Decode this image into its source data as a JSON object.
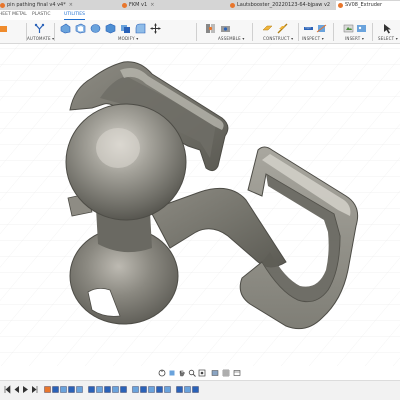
{
  "tabs": [
    {
      "label": "pin pathing final v4 v4*",
      "close": "×"
    },
    {
      "label": "FKM v1",
      "close": "×"
    },
    {
      "label": "Lautsbooster_20220123-64-bjpaw v2",
      "close": "×"
    },
    {
      "label": "SV08_Extruder",
      "close": "×"
    }
  ],
  "environments": [
    "SHEET METAL",
    "PLASTIC",
    "UTILITIES"
  ],
  "toolbar": {
    "groups": [
      "AUTOMATE ▾",
      "MODIFY ▾",
      "ASSEMBLE ▾",
      "CONSTRUCT ▾",
      "INSPECT ▾",
      "INSERT ▾",
      "SELECT ▾"
    ],
    "icons": [
      "automate-icon",
      "extrude-icon",
      "shell-icon",
      "revolve-icon",
      "box-icon",
      "combine-icon",
      "fillet-icon",
      "move-icon",
      "joint-icon",
      "joint-origin-icon",
      "plane-icon",
      "axis-icon",
      "measure-icon",
      "section-icon",
      "insert-icon",
      "image-icon",
      "select-icon"
    ]
  },
  "model": {
    "description_name": "3d-part-clip-with-ball-joint",
    "accent": "#6b6a63"
  },
  "navbar": {
    "icons": [
      "orbit-icon",
      "pan-icon",
      "look-at-icon",
      "zoom-icon",
      "zoom-window-icon",
      "display-settings-icon",
      "grid-icon",
      "viewport-settings-icon"
    ]
  },
  "timeline": {
    "controls": [
      "go-to-start-icon",
      "step-back-icon",
      "play-icon",
      "step-forward-icon",
      "go-to-end-icon"
    ]
  },
  "colors": {
    "accent_blue": "#1e6fd1",
    "tab_dot": "#e8762c",
    "model_base": "#6f6e66"
  }
}
